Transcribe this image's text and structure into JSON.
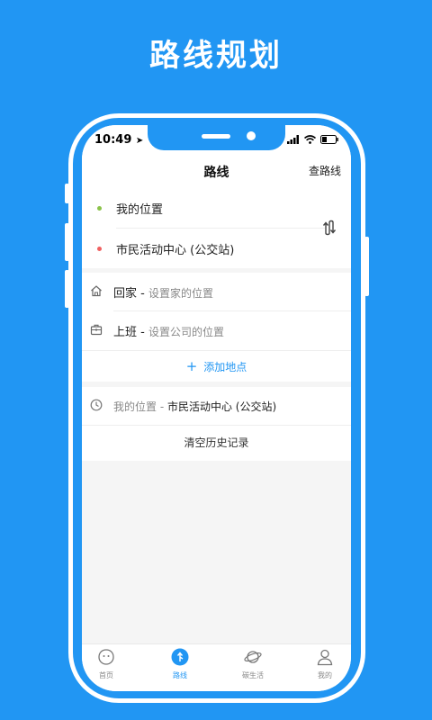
{
  "promo": {
    "headline": "路线规划"
  },
  "status_bar": {
    "time": "10:49"
  },
  "nav": {
    "title": "路线",
    "action": "查路线"
  },
  "route": {
    "start": {
      "label": "我的位置",
      "dot_color": "#8bc34a"
    },
    "end": {
      "label": "市民活动中心 (公交站)",
      "dot_color": "#f06060"
    }
  },
  "places": [
    {
      "name": "回家",
      "hint": "设置家的位置",
      "icon": "home-icon"
    },
    {
      "name": "上班",
      "hint": "设置公司的位置",
      "icon": "briefcase-icon"
    }
  ],
  "add_place": {
    "label": "添加地点"
  },
  "history": [
    {
      "from": "我的位置",
      "to": "市民活动中心 (公交站)",
      "icon": "clock-icon"
    }
  ],
  "clear_history": "清空历史记录",
  "tabs": [
    {
      "label": "首页",
      "icon": "home-face-icon",
      "active": false
    },
    {
      "label": "路线",
      "icon": "route-icon",
      "active": true
    },
    {
      "label": "碳生活",
      "icon": "planet-icon",
      "active": false
    },
    {
      "label": "我的",
      "icon": "user-icon",
      "active": false
    }
  ],
  "colors": {
    "accent": "#2196f3",
    "background": "#2196f3"
  }
}
